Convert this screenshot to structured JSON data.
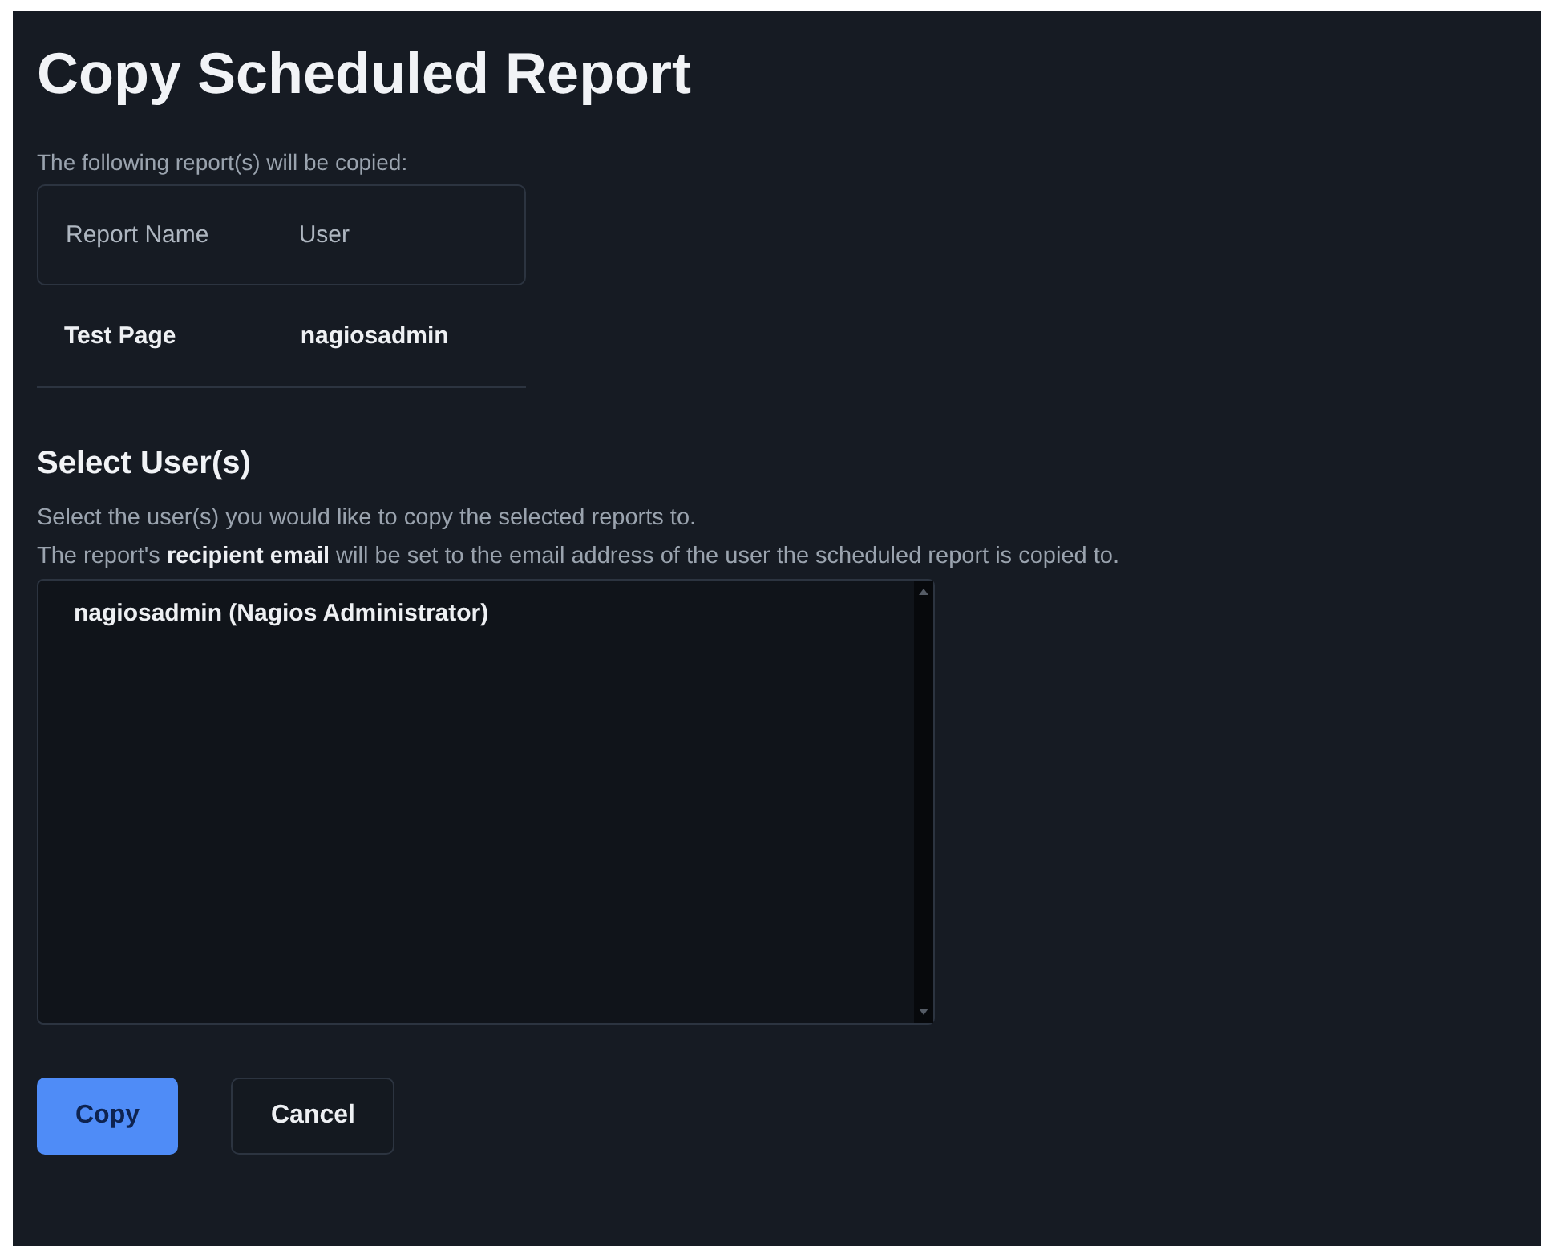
{
  "title": "Copy Scheduled Report",
  "intro": "The following report(s) will be copied:",
  "table": {
    "columns": [
      "Report Name",
      "User"
    ],
    "rows": [
      [
        "Test Page",
        "nagiosadmin"
      ]
    ]
  },
  "section_title": "Select User(s)",
  "description": [
    "Select the user(s) you would like to copy the selected reports to.",
    "The report's **recipient email** will be set to the email address of the user the scheduled report is copied to."
  ],
  "user_list": {
    "options": [
      {
        "label": "nagiosadmin (Nagios Administrator)",
        "selected": false
      }
    ]
  },
  "buttons": [
    {
      "label": "Copy",
      "kind": "primary"
    },
    {
      "label": "Cancel",
      "kind": "secondary"
    }
  ]
}
